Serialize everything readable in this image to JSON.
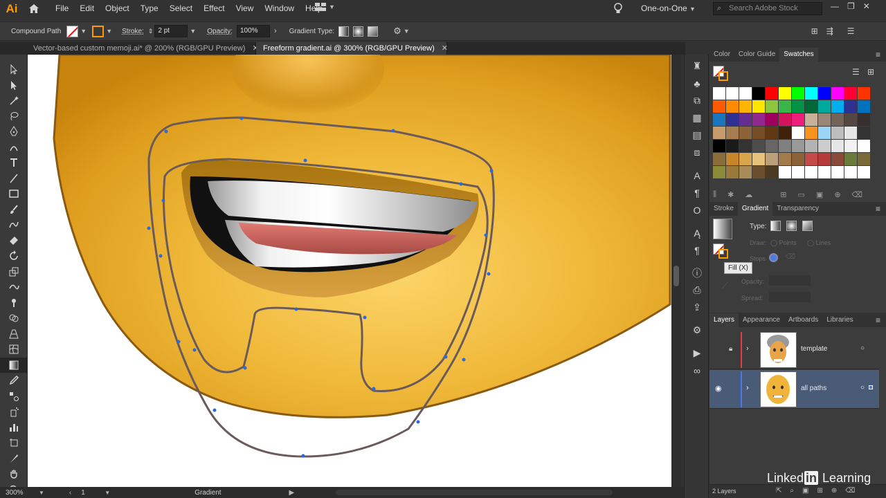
{
  "app": {
    "logo": "Ai"
  },
  "menu": [
    "File",
    "Edit",
    "Object",
    "Type",
    "Select",
    "Effect",
    "View",
    "Window",
    "Help"
  ],
  "workspace": "One-on-One",
  "search_placeholder": "Search Adobe Stock",
  "control": {
    "selection_type": "Compound Path",
    "stroke_label": "Stroke:",
    "stroke_value": "2 pt",
    "opacity_label": "Opacity:",
    "opacity_value": "100%",
    "gradient_type_label": "Gradient Type:"
  },
  "tabs": [
    {
      "label": "Vector-based custom memoji.ai* @ 200% (RGB/GPU Preview)",
      "active": false
    },
    {
      "label": "Freeform gradient.ai @ 300% (RGB/GPU Preview)",
      "active": true
    }
  ],
  "status": {
    "zoom": "300%",
    "artboard": "1",
    "tool": "Gradient"
  },
  "swatches_panel": {
    "tabs": [
      "Color",
      "Color Guide",
      "Swatches"
    ],
    "active_tab": "Swatches",
    "rows": [
      [
        "#ffffff",
        "#ffffff",
        "#ffffff",
        "#000000",
        "#ff0000",
        "#ffff00",
        "#00ff00",
        "#00ffff",
        "#0000ff",
        "#ff00ff",
        "#ff0033",
        "#ff3300"
      ],
      [
        "#ff5a00",
        "#ff8c00",
        "#ffb400",
        "#ffe600",
        "#8cc63f",
        "#39b54a",
        "#009245",
        "#006837",
        "#00a99d",
        "#00aeef",
        "#2e3192",
        "#0071bc"
      ],
      [
        "#1b75bc",
        "#2e3192",
        "#662d91",
        "#92278f",
        "#9e005d",
        "#d4145a",
        "#ed1e79",
        "#c7b299",
        "#998675",
        "#736357",
        "#534741",
        "#362f2d"
      ],
      [
        "#c69c6d",
        "#a67c52",
        "#8c6239",
        "#754c24",
        "#603813",
        "#42210b",
        "#ffffff",
        "#f7931e",
        "#9bd4f5",
        "#bdbdbd",
        "#e6e6e6",
        "#333333"
      ],
      [
        "#000000",
        "#1a1a1a",
        "#333333",
        "#4d4d4d",
        "#666666",
        "#808080",
        "#999999",
        "#b3b3b3",
        "#cccccc",
        "#e6e6e6",
        "#f2f2f2",
        "#ffffff"
      ],
      [
        "#8a6d3b",
        "#c8862a",
        "#d9a54a",
        "#e7c27a",
        "#bda07a",
        "#a27b4d",
        "#8c6239",
        "#c44a4a",
        "#b53a3a",
        "#8a4a3a",
        "#6a7a3a",
        "#7a6a3a"
      ],
      [
        "#8a8a3a",
        "#9a7a3a",
        "#a98b5a",
        "#6b4e2e",
        "#4d3a22",
        "#ffffff",
        "#ffffff",
        "#ffffff",
        "#ffffff",
        "#ffffff",
        "#ffffff",
        "#ffffff"
      ]
    ]
  },
  "gradient_panel": {
    "tabs": [
      "Stroke",
      "Gradient",
      "Transparency"
    ],
    "active_tab": "Gradient",
    "type_label": "Type:",
    "draw_label": "Draw:",
    "points_label": "Points",
    "lines_label": "Lines",
    "stops_label": "Stops",
    "opacity_label": "Opacity:",
    "spread_label": "Spread:"
  },
  "tooltip": "Fill (X)",
  "layers_panel": {
    "tabs": [
      "Layers",
      "Appearance",
      "Artboards",
      "Libraries"
    ],
    "active_tab": "Layers",
    "layers": [
      {
        "name": "template",
        "locked": true,
        "visible": false,
        "color": "#e04040",
        "selected": false
      },
      {
        "name": "all paths",
        "locked": false,
        "visible": true,
        "color": "#4a78f0",
        "selected": true
      }
    ],
    "count": "2 Layers"
  },
  "watermark": {
    "pre": "Linked",
    "in": "in",
    "post": " Learning"
  }
}
